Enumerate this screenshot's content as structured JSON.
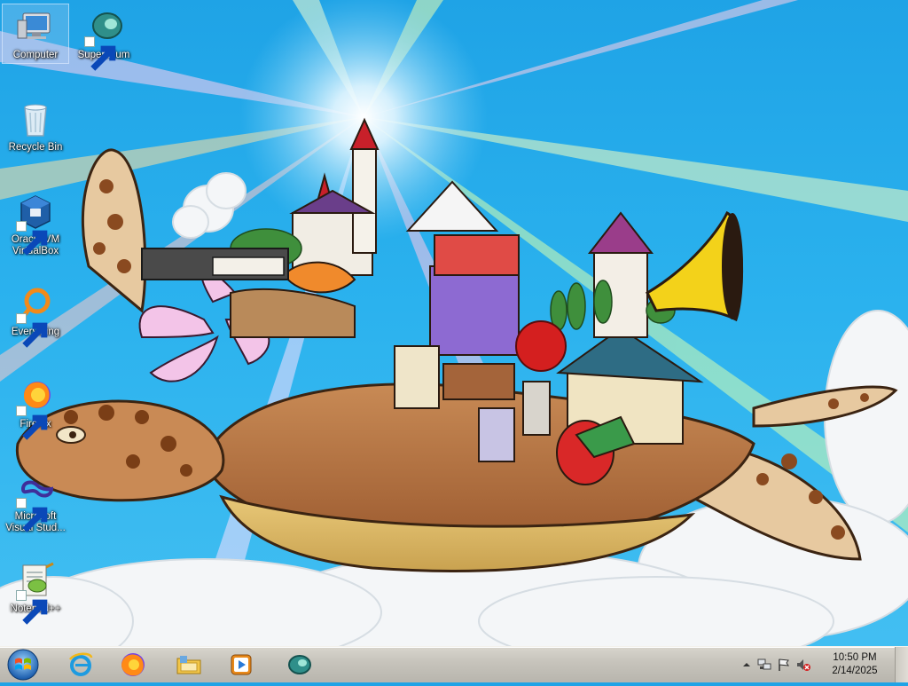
{
  "desktop": {
    "icons": [
      {
        "label": "Computer",
        "icon": "computer-icon",
        "shortcut": false,
        "selected": true
      },
      {
        "label": "Supermium",
        "icon": "supermium-icon",
        "shortcut": true,
        "selected": false
      },
      {
        "label": "Recycle Bin",
        "icon": "recycle-bin-icon",
        "shortcut": false,
        "selected": false
      },
      {
        "label": "Oracle VM VirtualBox",
        "icon": "virtualbox-icon",
        "shortcut": true,
        "selected": false
      },
      {
        "label": "Everything",
        "icon": "everything-search-icon",
        "shortcut": true,
        "selected": false
      },
      {
        "label": "Firefox",
        "icon": "firefox-icon",
        "shortcut": true,
        "selected": false
      },
      {
        "label": "Microsoft Visual Stud...",
        "icon": "visual-studio-icon",
        "shortcut": true,
        "selected": false
      },
      {
        "label": "Notepad++",
        "icon": "notepad-plus-plus-icon",
        "shortcut": true,
        "selected": false
      }
    ],
    "wallpaper": "turtle-castle-fantasy-wallpaper"
  },
  "taskbar": {
    "start_button": "windows-start-orb",
    "pinned": [
      {
        "name": "Internet Explorer",
        "icon": "internet-explorer-icon"
      },
      {
        "name": "Firefox",
        "icon": "firefox-icon"
      },
      {
        "name": "File Explorer",
        "icon": "folder-library-icon"
      },
      {
        "name": "Windows Media Player",
        "icon": "media-player-icon"
      },
      {
        "name": "Supermium",
        "icon": "supermium-icon"
      }
    ],
    "tray": {
      "icons": [
        "show-hidden-icons-arrow",
        "network-icon",
        "action-center-flag-icon",
        "volume-muted-icon"
      ],
      "time": "10:50 PM",
      "date": "2/14/2025"
    }
  },
  "colors": {
    "sky": "#2bb2ee",
    "taskbar": "#c6c3bb",
    "label_text": "#ffffff"
  }
}
